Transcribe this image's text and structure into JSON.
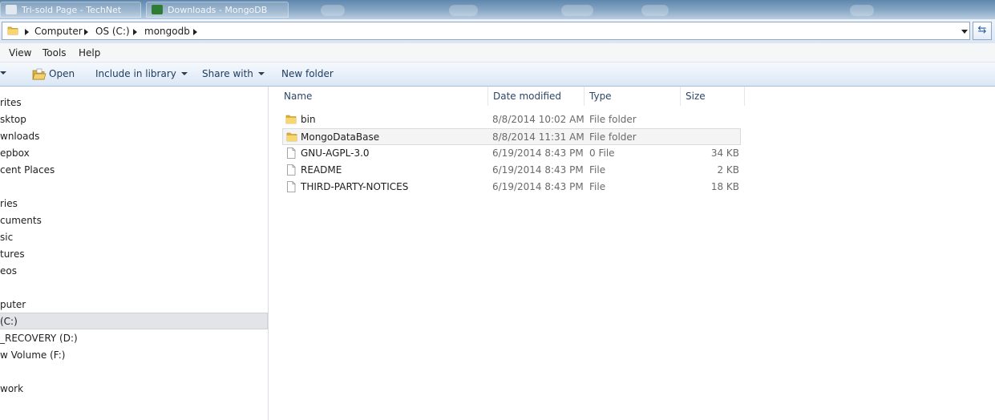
{
  "window": {
    "tabs": [
      {
        "label": "Tri-sold Page - TechNet"
      },
      {
        "label": "Downloads - MongoDB"
      }
    ]
  },
  "address": {
    "crumbs": [
      "Computer",
      "OS (C:)",
      "mongodb"
    ]
  },
  "menu": {
    "items": [
      "View",
      "Tools",
      "Help"
    ]
  },
  "commands": {
    "open": "Open",
    "include_in_library": "Include in library",
    "share_with": "Share with",
    "new_folder": "New folder"
  },
  "nav": {
    "items": [
      {
        "label": "rites"
      },
      {
        "label": "sktop"
      },
      {
        "label": "wnloads"
      },
      {
        "label": "epbox"
      },
      {
        "label": "cent Places"
      },
      {
        "label": "ries"
      },
      {
        "label": "cuments"
      },
      {
        "label": "sic"
      },
      {
        "label": "tures"
      },
      {
        "label": "eos"
      },
      {
        "label": "puter"
      },
      {
        "label": "(C:)"
      },
      {
        "label": "_RECOVERY (D:)"
      },
      {
        "label": "w Volume (F:)"
      },
      {
        "label": "work"
      }
    ]
  },
  "columns": {
    "name": "Name",
    "date": "Date modified",
    "type": "Type",
    "size": "Size"
  },
  "files": [
    {
      "name": "bin",
      "date": "8/8/2014 10:02 AM",
      "type": "File folder",
      "size": "",
      "icon": "folder-icon"
    },
    {
      "name": "MongoDataBase",
      "date": "8/8/2014 11:31 AM",
      "type": "File folder",
      "size": "",
      "icon": "folder-icon"
    },
    {
      "name": "GNU-AGPL-3.0",
      "date": "6/19/2014 8:43 PM",
      "type": "0 File",
      "size": "34 KB",
      "icon": "file-icon"
    },
    {
      "name": "README",
      "date": "6/19/2014 8:43 PM",
      "type": "File",
      "size": "2 KB",
      "icon": "file-icon"
    },
    {
      "name": "THIRD-PARTY-NOTICES",
      "date": "6/19/2014 8:43 PM",
      "type": "File",
      "size": "18 KB",
      "icon": "file-icon"
    }
  ],
  "colors": {
    "accent": "#1e3a5c",
    "folder": "#f0c94a",
    "selection": "#e2e4e7"
  }
}
